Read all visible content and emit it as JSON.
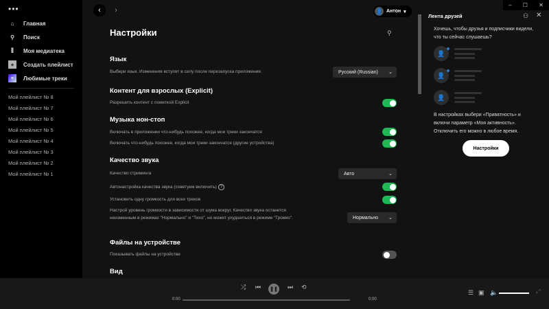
{
  "sidebar": {
    "menu": "•••",
    "nav": [
      {
        "label": "Главная",
        "icon": "home-icon"
      },
      {
        "label": "Поиск",
        "icon": "search-icon"
      },
      {
        "label": "Моя медиатека",
        "icon": "library-icon"
      },
      {
        "label": "Создать плейлист",
        "icon": "plus-icon"
      },
      {
        "label": "Любимые треки",
        "icon": "heart-icon"
      }
    ],
    "playlists": [
      "Мой плейлист № 8",
      "Мой плейлист № 7",
      "Мой плейлист № 6",
      "Мой плейлист № 5",
      "Мой плейлист № 4",
      "Мой плейлист № 3",
      "Мой плейлист № 2",
      "Мой плейлист № 1"
    ]
  },
  "header": {
    "user": "Антон",
    "back": "‹",
    "forward": "›"
  },
  "settings": {
    "title": "Настройки",
    "language": {
      "heading": "Язык",
      "desc": "Выбери язык. Изменения вступят в силу после перезапуска приложения.",
      "value": "Русский (Russian)"
    },
    "explicit": {
      "heading": "Контент для взрослых (Explicit)",
      "desc": "Разрешить контент с пометкой Explicit",
      "on": true
    },
    "autoplay": {
      "heading": "Музыка нон-стоп",
      "desc1": "Включать в приложении что-нибудь похожее, когда мои треки закончатся",
      "on1": true,
      "desc2": "Включать что-нибудь похожее, когда мои треки закончатся (другие устройства)",
      "on2": true
    },
    "quality": {
      "heading": "Качество звука",
      "streaming_label": "Качество стриминга",
      "streaming_value": "Авто",
      "auto_label": "Автонастройка качества звука (советуем включить)",
      "auto_on": true,
      "normalize_label": "Установить одну громкость для всех треков",
      "normalize_on": true,
      "level_desc": "Настрой уровень громкости в зависимости от шума вокруг. Качество звука останется неизменным в режимах \"Нормально\" и \"Тихо\", но может ухудшиться в режиме \"Громко\".",
      "level_value": "Нормально"
    },
    "local": {
      "heading": "Файлы на устройстве",
      "desc": "Показывать файлы на устройстве",
      "on": false
    },
    "view": {
      "heading": "Вид"
    }
  },
  "friends": {
    "title": "Лента друзей",
    "prompt": "Хочешь, чтобы друзья и подписчики видели, что ты сейчас слушаешь?",
    "info": "В настройках выбери «Приватность» и включи параметр «Моя активность». Отключить его можно в любое время.",
    "button": "Настройки"
  },
  "player": {
    "elapsed": "0:00",
    "total": "0:00",
    "volume": 1.0,
    "progress": 0
  },
  "colors": {
    "accent": "#1db954",
    "bg": "#121212",
    "sidebar": "#000000",
    "player": "#181818"
  }
}
